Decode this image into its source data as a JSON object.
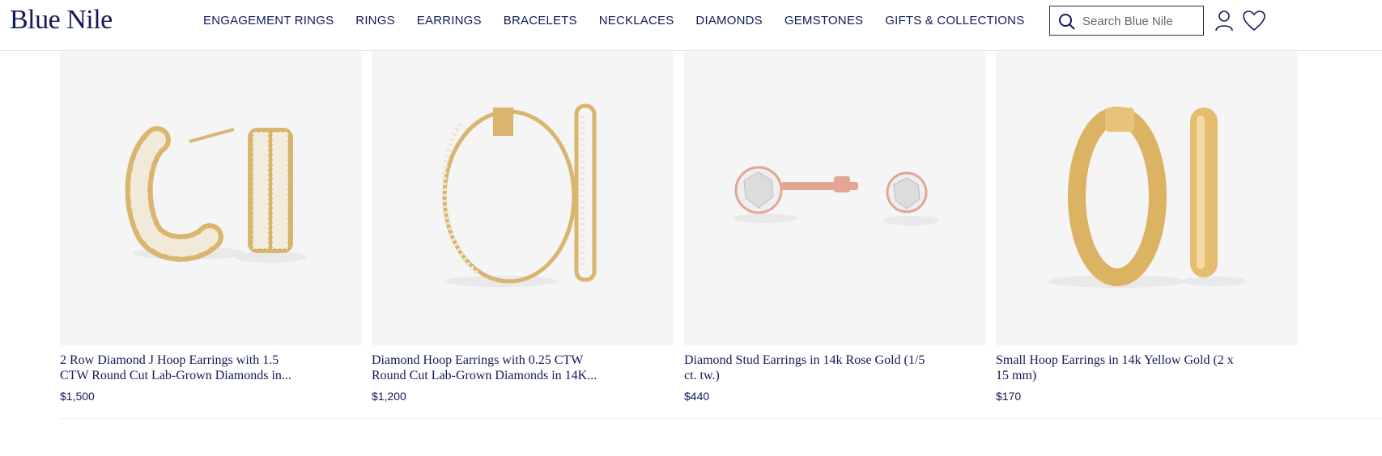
{
  "header": {
    "logo": "Blue Nile",
    "nav": [
      "ENGAGEMENT RINGS",
      "RINGS",
      "EARRINGS",
      "BRACELETS",
      "NECKLACES",
      "DIAMONDS",
      "GEMSTONES",
      "GIFTS & COLLECTIONS"
    ],
    "search_placeholder": "Search Blue Nile",
    "icons": [
      "search-icon",
      "account-icon",
      "wishlist-heart-icon"
    ]
  },
  "products": [
    {
      "title_line1": "2 Row Diamond J Hoop Earrings with 1.5",
      "title_line2": "CTW Round Cut Lab-Grown Diamonds in...",
      "price": "$1,500"
    },
    {
      "title_line1": "Diamond Hoop Earrings with 0.25 CTW",
      "title_line2": "Round Cut Lab-Grown Diamonds in 14K...",
      "price": "$1,200"
    },
    {
      "title_line1": "Diamond Stud Earrings in 14k Rose Gold (1/5",
      "title_line2": "ct. tw.)",
      "price": "$440"
    },
    {
      "title_line1": "Small Hoop Earrings in 14k Yellow Gold (2 x",
      "title_line2": "15 mm)",
      "price": "$170"
    }
  ],
  "colors": {
    "brand": "#12195a",
    "image_bg": "#f5f5f5",
    "gold": "#d9b56e",
    "rose_gold": "#e3a596"
  }
}
